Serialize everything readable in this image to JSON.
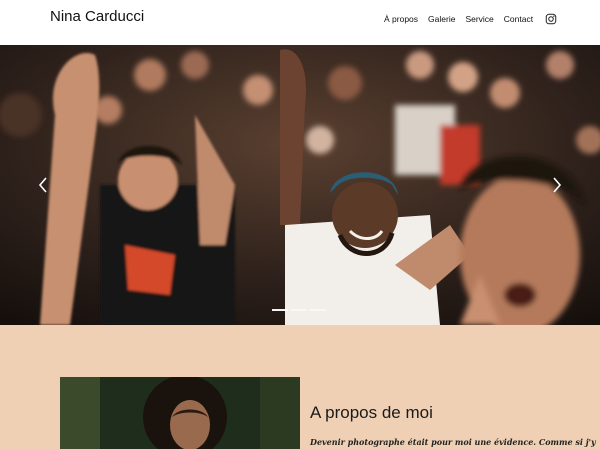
{
  "site": {
    "name": "Nina Carducci"
  },
  "nav": {
    "items": [
      {
        "label": "À propos"
      },
      {
        "label": "Galerie"
      },
      {
        "label": "Service"
      },
      {
        "label": "Contact"
      }
    ],
    "social_icon": "instagram-icon"
  },
  "hero": {
    "image": "concert crowd cheering",
    "prev_icon": "chevron-left-icon",
    "next_icon": "chevron-right-icon",
    "slide_count": 3,
    "active_slide": 1
  },
  "about": {
    "title": "A propos de moi",
    "text": "Devenir photographe était pour moi une évidence. Comme si j'y",
    "image": "portrait of a woman with curly hair"
  },
  "colors": {
    "background": "#f0d0b5",
    "header": "#ffffff",
    "text": "#111111"
  }
}
